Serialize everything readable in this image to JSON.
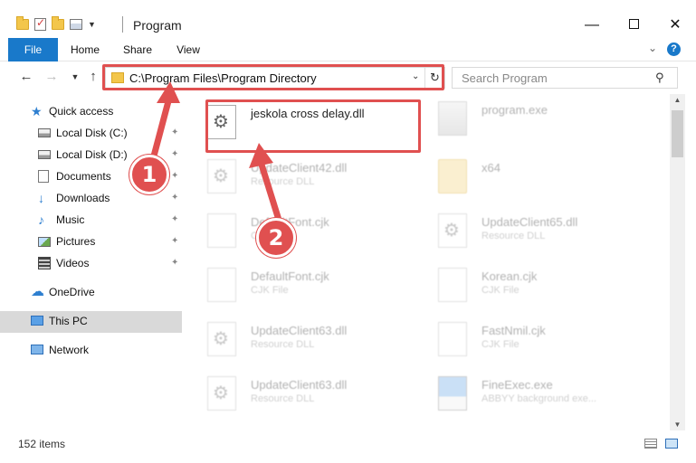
{
  "window": {
    "title": "Program",
    "minimize_glyph": "—",
    "maximize_label": "",
    "close_glyph": "✕"
  },
  "ribbon": {
    "tabs": [
      "File",
      "Home",
      "Share",
      "View"
    ],
    "collapse_glyph": "⌄",
    "help_glyph": "?"
  },
  "address": {
    "path": "C:\\Program Files\\Program Directory",
    "dropdown_glyph": "⌄",
    "refresh_glyph": "↻",
    "back_glyph": "←",
    "forward_glyph": "→",
    "recent_glyph": "▼",
    "up_glyph": "↑"
  },
  "search": {
    "placeholder": "Search Program",
    "icon_glyph": "⚲"
  },
  "navpane": {
    "quick_access": "Quick access",
    "items": [
      {
        "label": "Local Disk (C:)",
        "icon": "disk-icon",
        "pinned": true
      },
      {
        "label": "Local Disk (D:)",
        "icon": "disk-icon",
        "pinned": true
      },
      {
        "label": "Documents",
        "icon": "documents-icon",
        "pinned": true
      },
      {
        "label": "Downloads",
        "icon": "downloads-icon",
        "pinned": true
      },
      {
        "label": "Music",
        "icon": "music-icon",
        "pinned": true
      },
      {
        "label": "Pictures",
        "icon": "pictures-icon",
        "pinned": true
      },
      {
        "label": "Videos",
        "icon": "videos-icon",
        "pinned": true
      }
    ],
    "onedrive": "OneDrive",
    "this_pc": "This PC",
    "network": "Network",
    "pin_glyph": "📌"
  },
  "files": [
    {
      "name": "jeskola cross delay.dll",
      "type": "",
      "icon": "gear-file-icon",
      "highlighted": true
    },
    {
      "name": "program.exe",
      "type": "",
      "icon": "exe-icon"
    },
    {
      "name": "UpdateClient42.dll",
      "type": "Resource DLL",
      "icon": "gear-file-icon"
    },
    {
      "name": "x64",
      "type": "",
      "icon": "folder-icon"
    },
    {
      "name": "DefaultFont.cjk",
      "type": "CJK File",
      "icon": "document-icon"
    },
    {
      "name": "UpdateClient65.dll",
      "type": "Resource DLL",
      "icon": "gear-file-icon"
    },
    {
      "name": "DefaultFont.cjk",
      "type": "CJK File",
      "icon": "document-icon"
    },
    {
      "name": "Korean.cjk",
      "type": "CJK File",
      "icon": "document-icon"
    },
    {
      "name": "UpdateClient63.dll",
      "type": "Resource DLL",
      "icon": "gear-file-icon"
    },
    {
      "name": "FastNmil.cjk",
      "type": "CJK File",
      "icon": "document-icon"
    },
    {
      "name": "UpdateClient63.dll",
      "type": "Resource DLL",
      "icon": "gear-file-icon"
    },
    {
      "name": "FineExec.exe",
      "type": "ABBYY background exe...",
      "icon": "exe-icon"
    }
  ],
  "status": {
    "item_count": "152 items"
  },
  "callouts": [
    "1",
    "2"
  ],
  "colors": {
    "accent": "#1979ca",
    "highlight": "#e05050",
    "selected_nav": "#d9d9d9"
  }
}
